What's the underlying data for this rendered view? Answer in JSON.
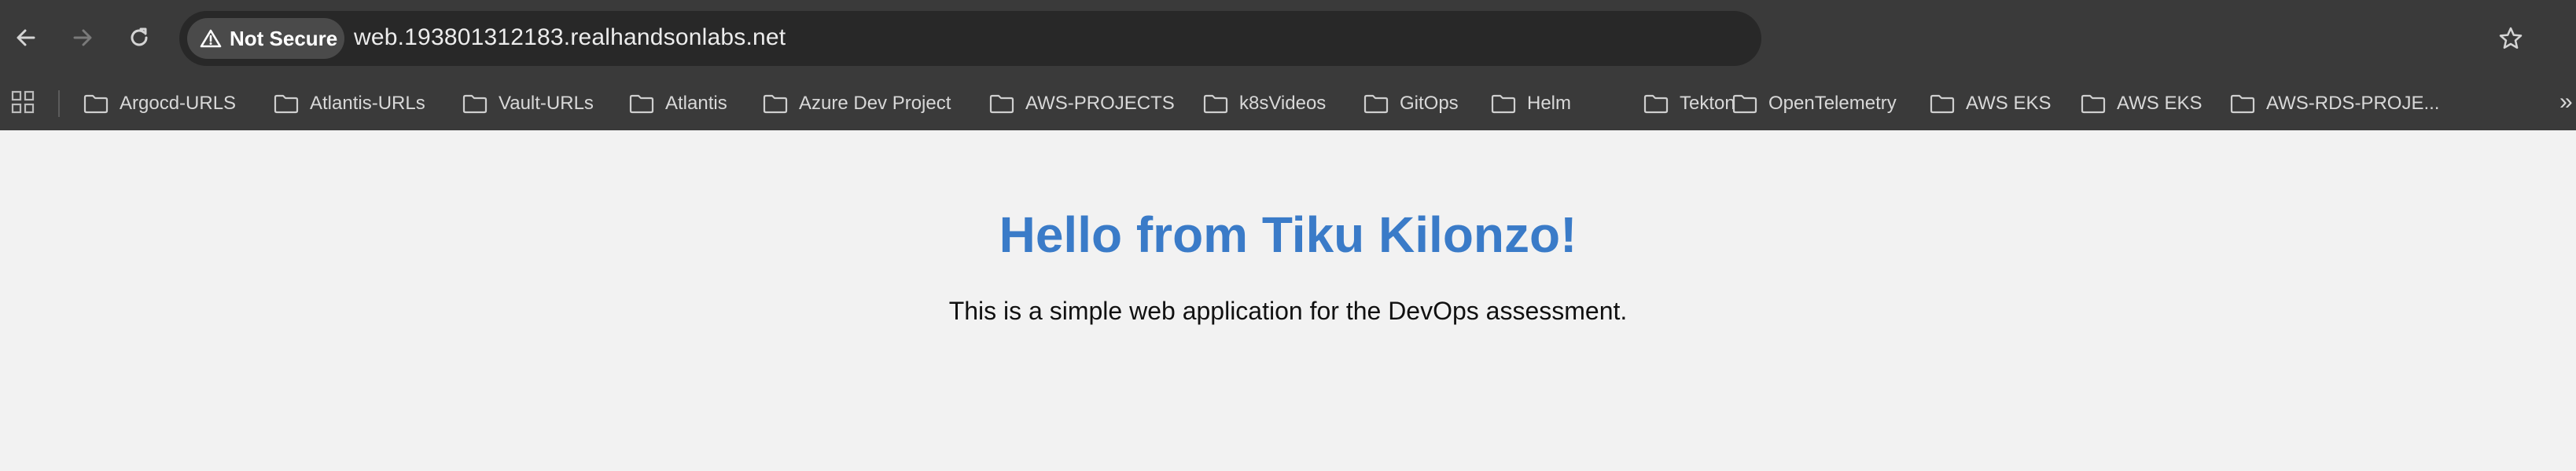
{
  "browser": {
    "security_chip": {
      "label": "Not Secure",
      "icon": "warning-triangle-icon"
    },
    "url": "web.193801312183.realhandsonlabs.net",
    "nav": {
      "back": "back-arrow-icon",
      "forward": "forward-arrow-icon",
      "reload": "reload-icon"
    },
    "star_icon": "star-icon"
  },
  "bookmarks": {
    "items": [
      {
        "label": "Argocd-URLS"
      },
      {
        "label": "Atlantis-URLs"
      },
      {
        "label": "Vault-URLs"
      },
      {
        "label": "Atlantis"
      },
      {
        "label": "Azure Dev Project"
      },
      {
        "label": "AWS-PROJECTS"
      },
      {
        "label": "k8sVideos"
      },
      {
        "label": "GitOps"
      },
      {
        "label": "Helm"
      },
      {
        "label": "Tekton"
      },
      {
        "label": "OpenTelemetry"
      },
      {
        "label": "AWS EKS"
      },
      {
        "label": "AWS EKS"
      },
      {
        "label": "AWS-RDS-PROJE..."
      }
    ],
    "more_label": "»"
  },
  "page": {
    "heading": "Hello from Tiku Kilonzo!",
    "text": "This is a simple web application for the DevOps assessment.",
    "heading_color": "#3a7bc8"
  }
}
